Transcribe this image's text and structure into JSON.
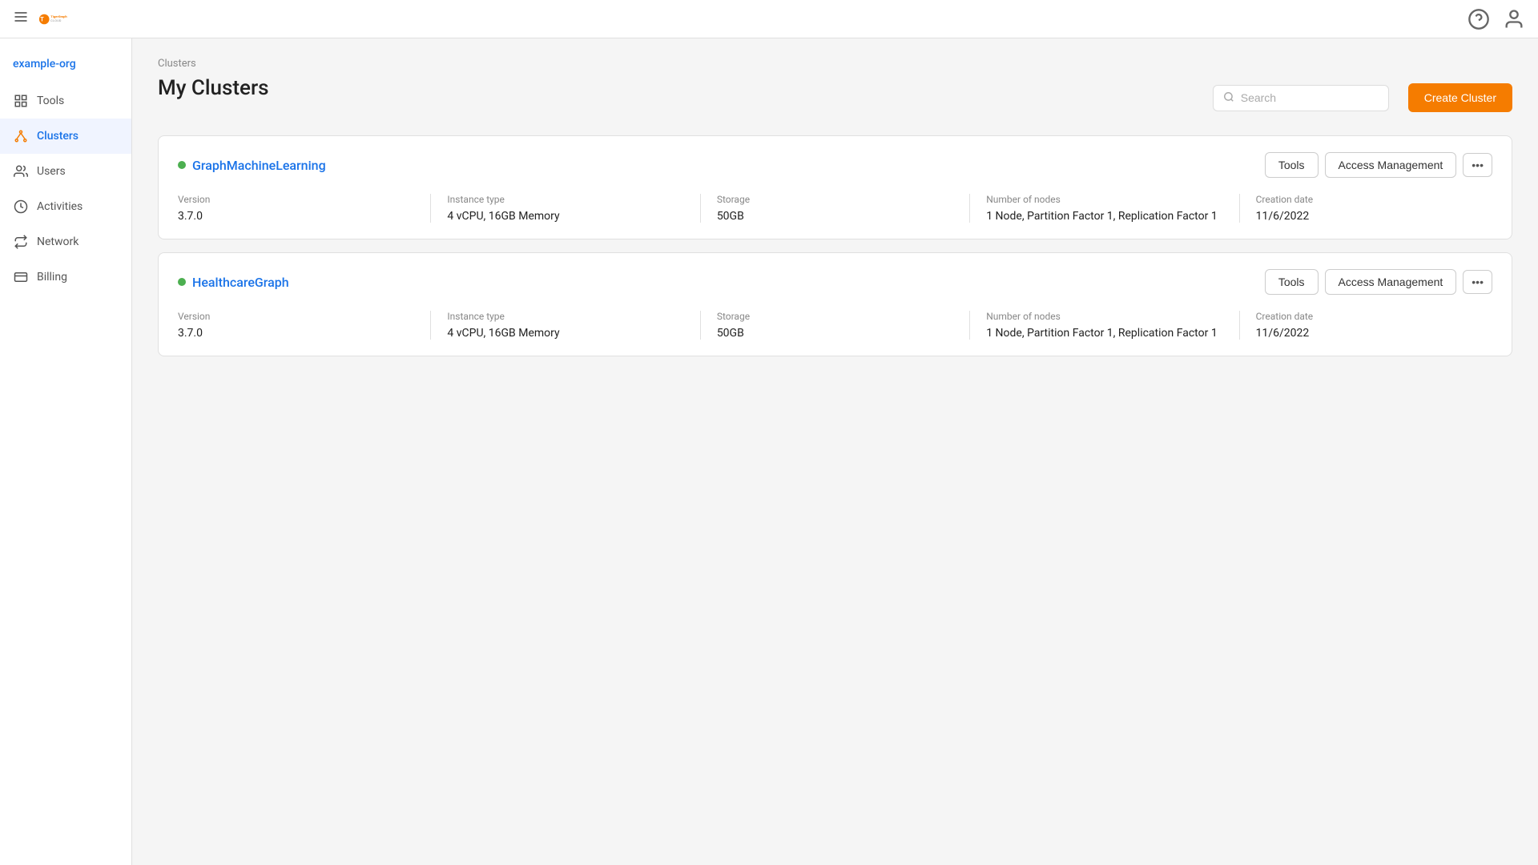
{
  "topbar": {
    "org_name": "example-org",
    "hamburger": "☰"
  },
  "sidebar": {
    "items": [
      {
        "id": "tools",
        "label": "Tools",
        "icon": "grid"
      },
      {
        "id": "clusters",
        "label": "Clusters",
        "icon": "cluster",
        "active": true
      },
      {
        "id": "users",
        "label": "Users",
        "icon": "users"
      },
      {
        "id": "activities",
        "label": "Activities",
        "icon": "activity"
      },
      {
        "id": "network",
        "label": "Network",
        "icon": "network"
      },
      {
        "id": "billing",
        "label": "Billing",
        "icon": "billing"
      }
    ]
  },
  "breadcrumb": "Clusters",
  "page_title": "My Clusters",
  "search_placeholder": "Search",
  "create_cluster_label": "Create Cluster",
  "clusters": [
    {
      "id": "cluster1",
      "name": "GraphMachineLearning",
      "status": "active",
      "tools_label": "Tools",
      "access_management_label": "Access Management",
      "version_label": "Version",
      "version_value": "3.7.0",
      "instance_type_label": "Instance type",
      "instance_type_value": "4 vCPU, 16GB Memory",
      "storage_label": "Storage",
      "storage_value": "50GB",
      "nodes_label": "Number of nodes",
      "nodes_value": "1 Node, Partition Factor 1, Replication Factor 1",
      "creation_date_label": "Creation date",
      "creation_date_value": "11/6/2022"
    },
    {
      "id": "cluster2",
      "name": "HealthcareGraph",
      "status": "active",
      "tools_label": "Tools",
      "access_management_label": "Access Management",
      "version_label": "Version",
      "version_value": "3.7.0",
      "instance_type_label": "Instance type",
      "instance_type_value": "4 vCPU, 16GB Memory",
      "storage_label": "Storage",
      "storage_value": "50GB",
      "nodes_label": "Number of nodes",
      "nodes_value": "1 Node, Partition Factor 1, Replication Factor 1",
      "creation_date_label": "Creation date",
      "creation_date_value": "11/6/2022"
    }
  ]
}
